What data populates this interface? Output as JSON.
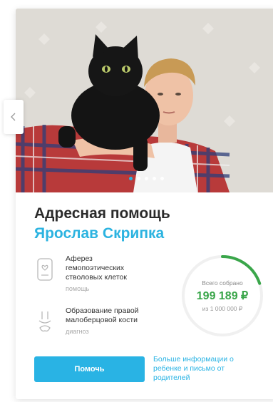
{
  "slider": {
    "dots": 5,
    "active_dot": 0
  },
  "card": {
    "title": "Адресная помощь",
    "name": "Ярослав Скрипка",
    "items": [
      {
        "icon": "cell-tube-icon",
        "text": "Аферез гемопоэтических стволовых клеток",
        "sub": "помощь"
      },
      {
        "icon": "bone-icon",
        "text": "Образование правой малоберцовой кости",
        "sub": "диагноз"
      }
    ],
    "collected": {
      "label": "Всего собрано",
      "amount": "199 189 ₽",
      "goal": "из 1 000 000 ₽",
      "progress_fraction": 0.199
    },
    "help_button": "Помочь",
    "more_link": "Больше информации о ребенке и письмо от родителей"
  },
  "colors": {
    "accent": "#29b3e4",
    "progress": "#3aa64a",
    "title": "#2b2b2b"
  }
}
